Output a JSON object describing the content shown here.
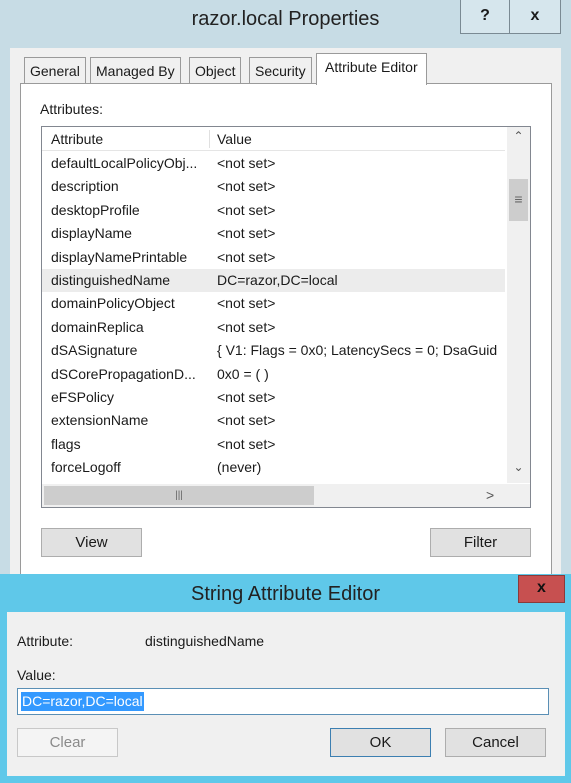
{
  "properties_window": {
    "title": "razor.local Properties",
    "help_label": "?",
    "close_label": "x",
    "tabs": [
      {
        "label": "General"
      },
      {
        "label": "Managed By"
      },
      {
        "label": "Object"
      },
      {
        "label": "Security"
      },
      {
        "label": "Attribute Editor",
        "active": true
      }
    ],
    "attributes_label": "Attributes:",
    "columns": [
      "Attribute",
      "Value"
    ],
    "rows": [
      {
        "attribute": "defaultLocalPolicyObj...",
        "value": "<not set>"
      },
      {
        "attribute": "description",
        "value": "<not set>"
      },
      {
        "attribute": "desktopProfile",
        "value": "<not set>"
      },
      {
        "attribute": "displayName",
        "value": "<not set>"
      },
      {
        "attribute": "displayNamePrintable",
        "value": "<not set>"
      },
      {
        "attribute": "distinguishedName",
        "value": "DC=razor,DC=local",
        "selected": true
      },
      {
        "attribute": "domainPolicyObject",
        "value": "<not set>"
      },
      {
        "attribute": "domainReplica",
        "value": "<not set>"
      },
      {
        "attribute": "dSASignature",
        "value": "{ V1: Flags = 0x0; LatencySecs = 0; DsaGuid"
      },
      {
        "attribute": "dSCorePropagationD...",
        "value": "0x0 = ( )"
      },
      {
        "attribute": "eFSPolicy",
        "value": "<not set>"
      },
      {
        "attribute": "extensionName",
        "value": "<not set>"
      },
      {
        "attribute": "flags",
        "value": "<not set>"
      },
      {
        "attribute": "forceLogoff",
        "value": "(never)"
      }
    ],
    "view_label": "View",
    "filter_label": "Filter"
  },
  "string_editor": {
    "title": "String Attribute Editor",
    "close_label": "x",
    "attribute_label": "Attribute:",
    "attribute_value": "distinguishedName",
    "value_label": "Value:",
    "value": "DC=razor,DC=local",
    "clear_label": "Clear",
    "ok_label": "OK",
    "cancel_label": "Cancel",
    "colors": {
      "frame": "#5fc8e9",
      "close": "#c75050",
      "selection": "#3399ff"
    }
  }
}
